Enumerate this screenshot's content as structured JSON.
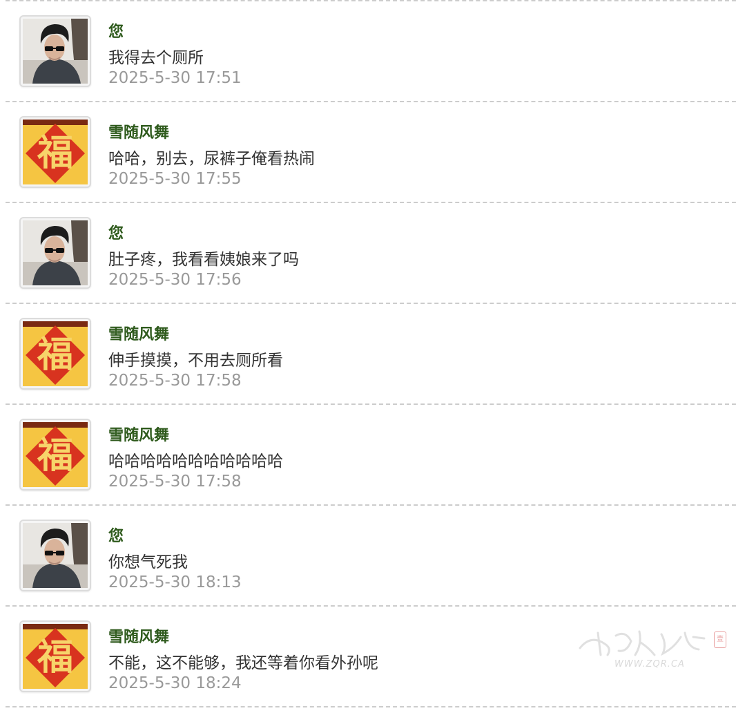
{
  "messages": [
    {
      "sender": "您",
      "avatar": "user-portrait-avatar",
      "text": "我得去个厕所",
      "time": "2025-5-30 17:51"
    },
    {
      "sender": "雪随风舞",
      "avatar": "fu-character-avatar",
      "text": "哈哈，别去，尿裤子俺看热闹",
      "time": "2025-5-30 17:55"
    },
    {
      "sender": "您",
      "avatar": "user-portrait-avatar",
      "text": "肚子疼，我看看姨娘来了吗",
      "time": "2025-5-30 17:56"
    },
    {
      "sender": "雪随风舞",
      "avatar": "fu-character-avatar",
      "text": "伸手摸摸，不用去厕所看",
      "time": "2025-5-30 17:58"
    },
    {
      "sender": "雪随风舞",
      "avatar": "fu-character-avatar",
      "text": "哈哈哈哈哈哈哈哈哈哈哈",
      "time": "2025-5-30 17:58"
    },
    {
      "sender": "您",
      "avatar": "user-portrait-avatar",
      "text": "你想气死我",
      "time": "2025-5-30 18:13"
    },
    {
      "sender": "雪随风舞",
      "avatar": "fu-character-avatar",
      "text": "不能，这不能够，我还等着你看外孙呢",
      "time": "2025-5-30 18:24"
    }
  ],
  "fu_glyph": "福",
  "watermark": {
    "text": "WWW.ZQR.CA",
    "seal": "壹"
  },
  "colors": {
    "name": "#2e5a1c",
    "message": "#333333",
    "time": "#999999",
    "separator": "#cccccc",
    "fu_red": "#d8331f",
    "fu_gold": "#f5c542"
  }
}
